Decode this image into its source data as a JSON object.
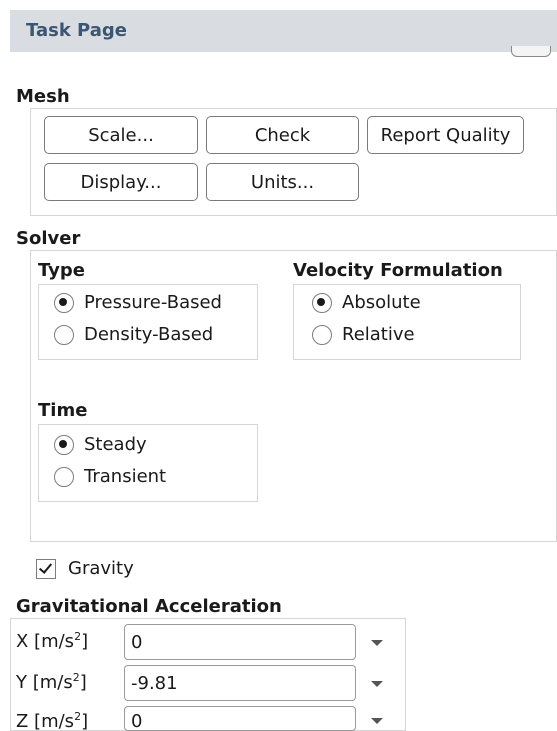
{
  "window": {
    "title": "Task Page"
  },
  "mesh": {
    "label": "Mesh",
    "buttons": {
      "scale": "Scale...",
      "check": "Check",
      "report_quality": "Report Quality",
      "display": "Display...",
      "units": "Units..."
    }
  },
  "solver": {
    "label": "Solver",
    "type": {
      "label": "Type",
      "options": [
        "Pressure-Based",
        "Density-Based"
      ],
      "selected": "Pressure-Based"
    },
    "velocity_formulation": {
      "label": "Velocity Formulation",
      "options": [
        "Absolute",
        "Relative"
      ],
      "selected": "Absolute"
    },
    "time": {
      "label": "Time",
      "options": [
        "Steady",
        "Transient"
      ],
      "selected": "Steady"
    }
  },
  "gravity": {
    "label": "Gravity",
    "checked": true
  },
  "grav_accel": {
    "label": "Gravitational Acceleration",
    "unit_superscript": "2",
    "fields": [
      {
        "axis": "X [m/s",
        "unit_end": "]",
        "value": "0"
      },
      {
        "axis": "Y [m/s",
        "unit_end": "]",
        "value": "-9.81"
      },
      {
        "axis": "Z [m/s",
        "unit_end": "]",
        "value": "0"
      }
    ]
  }
}
